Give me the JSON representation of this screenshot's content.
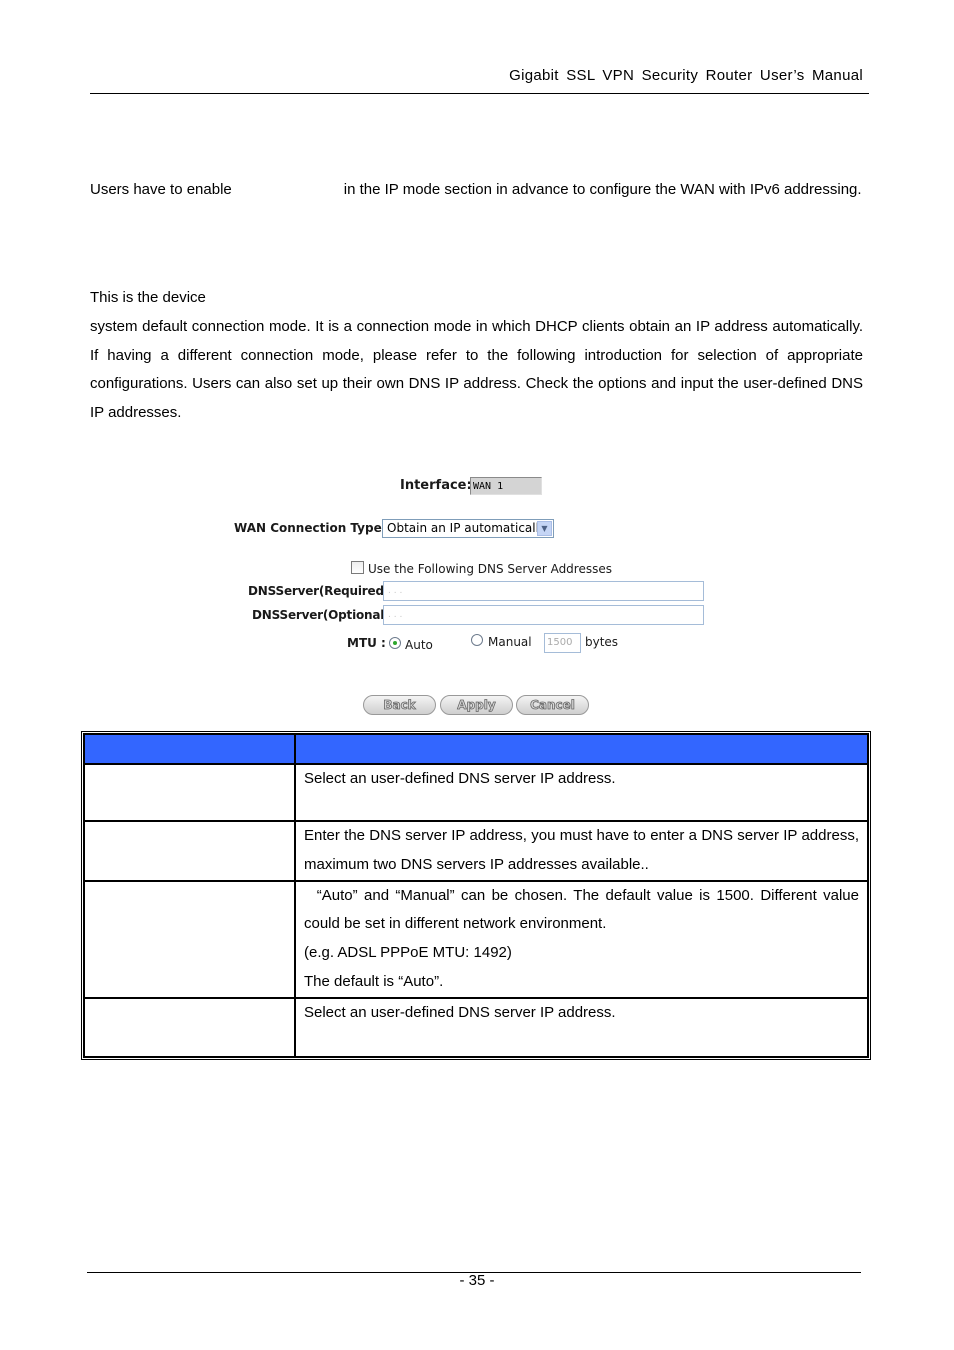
{
  "header": {
    "title": "Gigabit SSL VPN Security Router User’s Manual"
  },
  "paragraphs": {
    "ipv6_note_start": " Users have to enable",
    "ipv6_note_end": "in the IP mode section in advance to configure the WAN with IPv6 addressing.",
    "intro_first_line": "This is the device",
    "intro_rest": "system default connection mode. It is a connection mode in which DHCP clients obtain an IP address automatically. If having a different connection mode, please refer to the following introduction for selection of appropriate configurations. Users can also set up their own DNS IP address. Check the options and input the user-defined DNS IP addresses."
  },
  "ui": {
    "interface_label": "Interface:",
    "interface_value": "WAN 1",
    "wan_type_label": "WAN  Connection Type :",
    "wan_type_selected": "Obtain an IP automatically",
    "dns_checkbox_label": "Use the Following DNS Server Addresses",
    "dns_checkbox_checked": false,
    "dns_required_label": "DNSServer(Required) :",
    "dns_required_value": ". . .",
    "dns_optional_label": "DNSServer(Optional) :",
    "dns_optional_value": ". . .",
    "mtu_label": "MTU :",
    "mtu_auto_label": "Auto",
    "mtu_manual_label": "Manual",
    "mtu_selected": "Auto",
    "mtu_value": "1500",
    "mtu_unit": "bytes",
    "buttons": {
      "back": "Back",
      "apply": "Apply",
      "cancel": "Cancel"
    },
    "icons": {
      "select_arrow": "chevron-down-icon"
    }
  },
  "table": {
    "header_color": "#3366ff",
    "header": [
      "",
      ""
    ],
    "rows": [
      {
        "name": "",
        "desc": [
          "Select an user-defined DNS server IP address."
        ]
      },
      {
        "name": "",
        "desc": [
          "Enter the DNS server IP address, you must have to enter a DNS server IP address, maximum two DNS servers IP addresses available.."
        ]
      },
      {
        "name": "",
        "desc": [
          "  “Auto” and “Manual” can be chosen. The default value is 1500. Different value could be set in different network environment.",
          "(e.g. ADSL PPPoE MTU: 1492)",
          "The default is “Auto”."
        ]
      },
      {
        "name": "",
        "desc": [
          "Select an user-defined DNS server IP address."
        ]
      }
    ]
  },
  "footer": {
    "page_number": "- 35 -"
  }
}
